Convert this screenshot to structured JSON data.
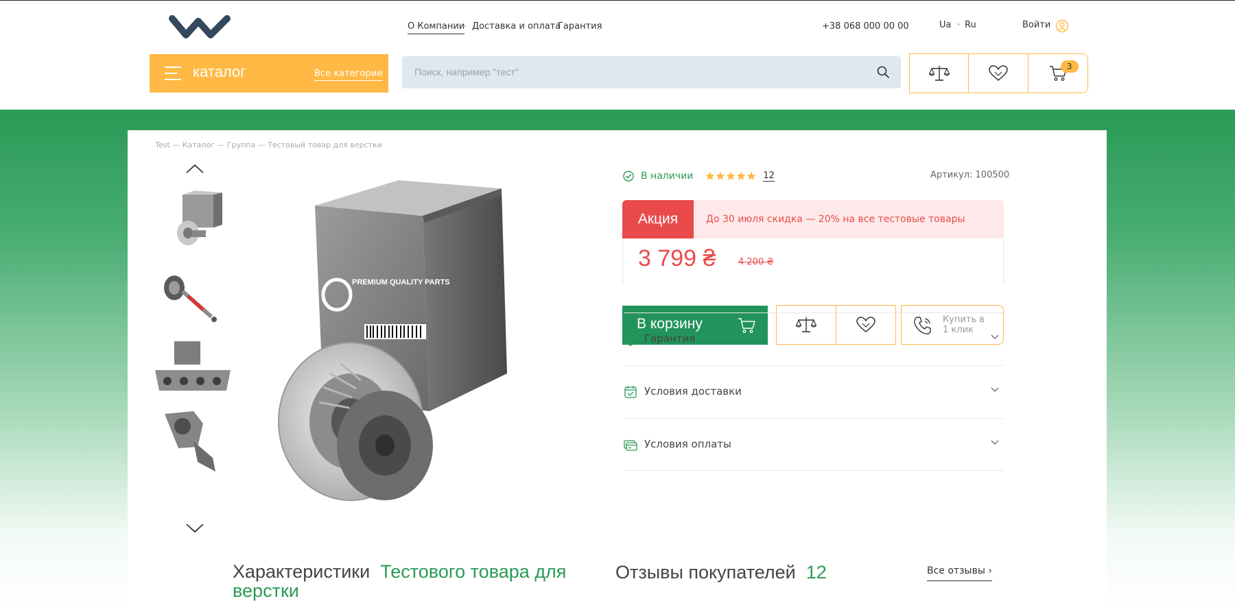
{
  "header": {
    "nav": [
      "О Компании",
      "Доставка и оплата",
      "Гарантия"
    ],
    "phone": "+38 068 000 00 00",
    "langs": [
      "Ua",
      "Ru"
    ],
    "login": "Войти",
    "catalog_label": "каталог",
    "all_categories": "Все категории",
    "search_placeholder": "Поиск, например \"тест\"",
    "cart_count": "3"
  },
  "breadcrumbs": "Test — Каталог — Группа — Тестовый товар для верстки",
  "product": {
    "stock": "В наличии",
    "rating_stars": 5,
    "reviews_count": "12",
    "sku": "Артикул: 100500",
    "promo_tag": "Акция",
    "promo_text": "До 30 июля скидка — 20% на все тестовые товары",
    "price": "3 799 ₴",
    "old_price": "4 200 ₴",
    "add_to_cart": "В корзину",
    "one_click_line1": "Купить в",
    "one_click_line2": "1 клик",
    "accordions": [
      "Гарантия",
      "Условия доставки",
      "Условия оплаты"
    ],
    "box_text": "PREMIUM QUALITY PARTS"
  },
  "sections": {
    "char_title": "Характеристики",
    "char_subtitle": "Тестового товара для верстки",
    "reviews_title": "Отзывы покупателей",
    "reviews_count": "12",
    "all_reviews": "Все отзывы"
  },
  "colors": {
    "accent_yellow": "#ffb944",
    "green": "#2a9a56",
    "red": "#e94b4b",
    "search_bg": "#dfe7ef"
  }
}
